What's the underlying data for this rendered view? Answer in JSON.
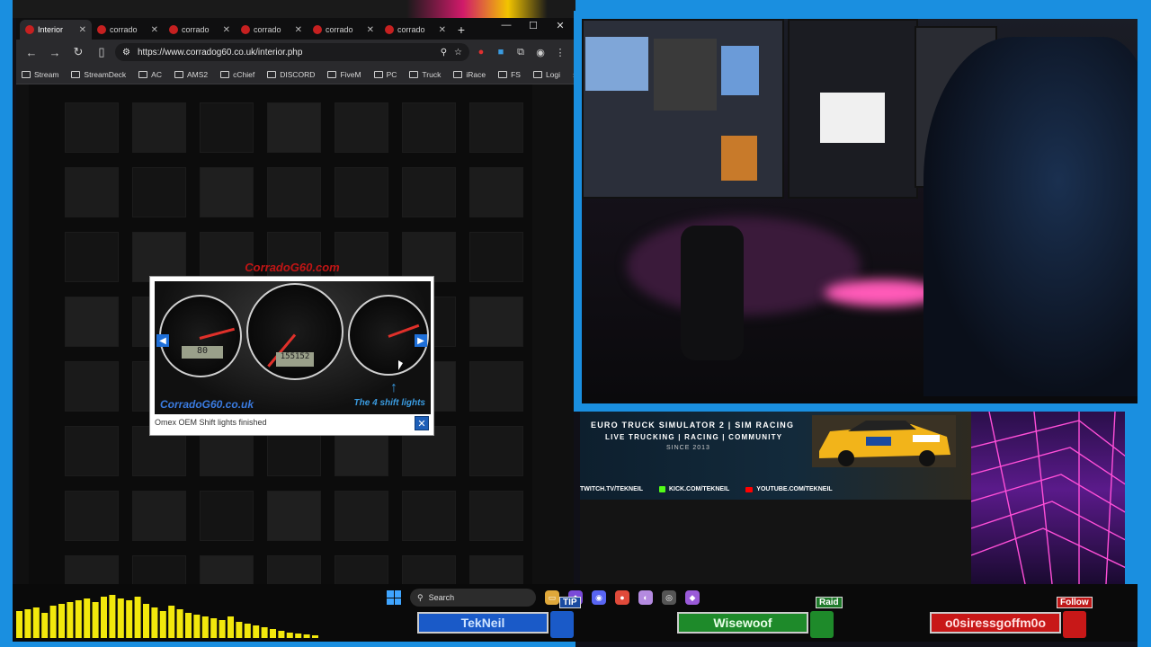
{
  "browser": {
    "tabs": [
      {
        "label": "Interior"
      },
      {
        "label": "corrado"
      },
      {
        "label": "corrado"
      },
      {
        "label": "corrado"
      },
      {
        "label": "corrado"
      },
      {
        "label": "corrado"
      }
    ],
    "url": "https://www.corradog60.co.uk/interior.php",
    "bookmarks": [
      "Stream",
      "StreamDeck",
      "AC",
      "AMS2",
      "cChief",
      "DISCORD",
      "FiveM",
      "PC",
      "Truck",
      "iRace",
      "FS",
      "Logi"
    ]
  },
  "lightbox": {
    "brand_top": "CorradoG60.com",
    "brand_bottom": "CorradoG60.co.uk",
    "shift_note": "The 4 shift lights",
    "lcd_top": "80",
    "lcd_bottom": "155152",
    "description": "Omex OEM Shift lights finished"
  },
  "banner": {
    "title": "EURO TRUCK SIMULATOR 2  |  SIM RACING",
    "subtitle": "LIVE TRUCKING  |  RACING  |  COMMUNITY",
    "since": "SINCE 2013",
    "links": [
      "TWITCH.TV/TEKNEIL",
      "KICK.COM/TEKNEIL",
      "YOUTUBE.COM/TEKNEIL"
    ]
  },
  "taskbar": {
    "search_placeholder": "Search"
  },
  "alerts": {
    "tip_label": "TIP",
    "tip_name": "TekNeil",
    "raid_label": "Raid",
    "raid_name": "Wisewoof",
    "follow_label": "Follow",
    "follow_name": "o0siressgoffm0o"
  },
  "colors": {
    "frame": "#1a8fe0",
    "equalizer": "#f2e80c"
  }
}
